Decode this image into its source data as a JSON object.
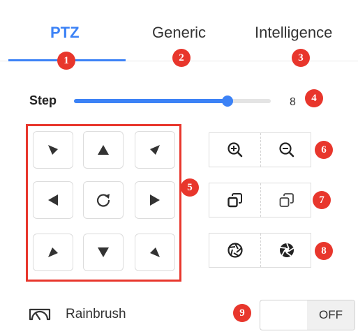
{
  "tabs": [
    {
      "label": "PTZ",
      "active": true
    },
    {
      "label": "Generic",
      "active": false
    },
    {
      "label": "Intelligence",
      "active": false
    }
  ],
  "step": {
    "label": "Step",
    "value": "8",
    "level_fraction": 0.78
  },
  "badges": [
    "1",
    "2",
    "3",
    "4",
    "5",
    "6",
    "7",
    "8",
    "9"
  ],
  "direction_pad": [
    {
      "name": "pan-up-left",
      "icon": "arrow-up-left-icon"
    },
    {
      "name": "pan-up",
      "icon": "arrow-up-icon"
    },
    {
      "name": "pan-up-right",
      "icon": "arrow-up-right-icon"
    },
    {
      "name": "pan-left",
      "icon": "arrow-left-icon"
    },
    {
      "name": "reset",
      "icon": "rotate-icon"
    },
    {
      "name": "pan-right",
      "icon": "arrow-right-icon"
    },
    {
      "name": "pan-down-left",
      "icon": "arrow-down-left-icon"
    },
    {
      "name": "pan-down",
      "icon": "arrow-down-icon"
    },
    {
      "name": "pan-down-right",
      "icon": "arrow-down-right-icon"
    }
  ],
  "controls": [
    {
      "group": "zoom",
      "left_icon": "zoom-in-icon",
      "right_icon": "zoom-out-icon"
    },
    {
      "group": "focus",
      "left_icon": "focus-near-icon",
      "right_icon": "focus-far-icon"
    },
    {
      "group": "iris",
      "left_icon": "iris-open-icon",
      "right_icon": "iris-close-icon"
    }
  ],
  "rainbrush": {
    "label": "Rainbrush",
    "icon": "wiper-icon",
    "toggle_label": "OFF"
  },
  "colors": {
    "accent": "#3c82f6",
    "badge": "#e8362c",
    "border": "#dcdcdc"
  }
}
